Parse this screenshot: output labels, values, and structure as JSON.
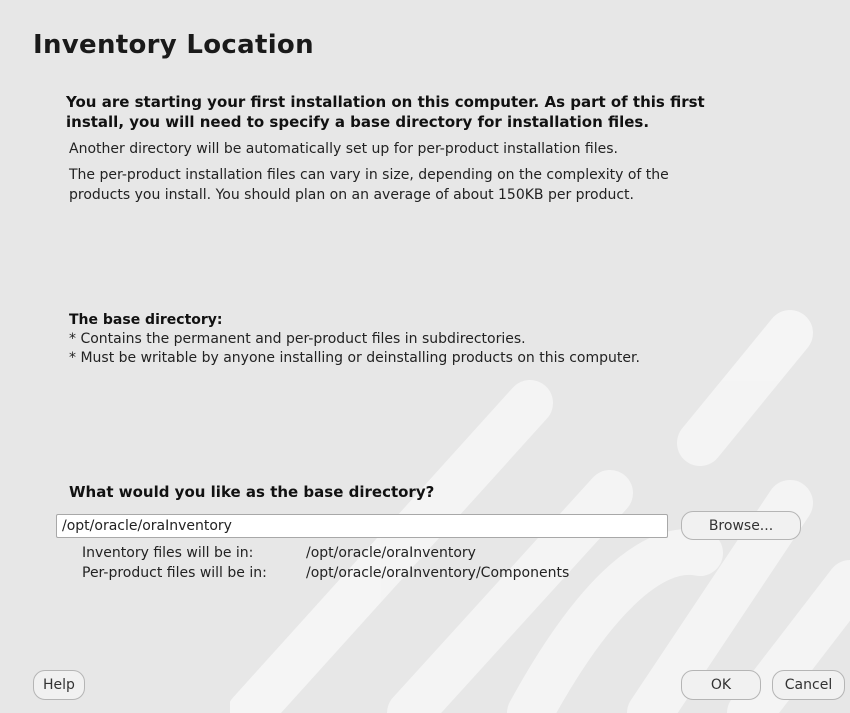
{
  "page": {
    "title": "Inventory Location"
  },
  "intro": {
    "bold_line_1": "You are starting your first installation on this computer. As part of this first",
    "bold_line_2": "install, you will need to specify a base directory for installation files.",
    "line_1": "Another directory will be automatically set up for per-product installation files.",
    "line_2": "The per-product installation files can vary in size, depending on the complexity of the",
    "line_3": "products you install.  You should plan on an average of about 150KB per product."
  },
  "base_directory": {
    "heading": "The base directory:",
    "bullet_1": "* Contains the permanent and per-product files in subdirectories.",
    "bullet_2": "* Must be writable by anyone installing or deinstalling products on this computer."
  },
  "question": {
    "label": "What would you like as the base directory?",
    "input_value": "/opt/oracle/oraInventory",
    "browse_label": "Browse..."
  },
  "info": {
    "inventory_label": "Inventory files will be in:",
    "inventory_value": "/opt/oracle/oraInventory",
    "per_product_label": "Per-product files will be in:",
    "per_product_value": "/opt/oracle/oraInventory/Components"
  },
  "footer": {
    "help_label": "Help",
    "ok_label": "OK",
    "cancel_label": "Cancel"
  }
}
